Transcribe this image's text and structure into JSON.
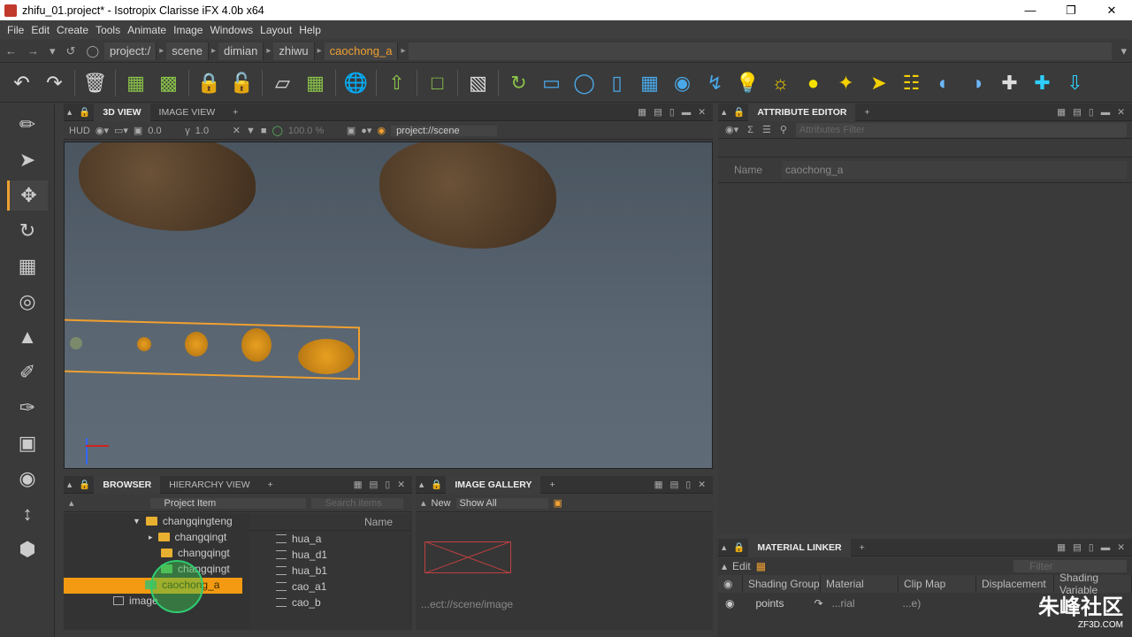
{
  "window": {
    "title": "zhifu_01.project* - Isotropix Clarisse iFX 4.0b x64"
  },
  "menu": [
    "File",
    "Edit",
    "Create",
    "Tools",
    "Animate",
    "Image",
    "Windows",
    "Layout",
    "Help"
  ],
  "path": {
    "items": [
      "project:/",
      "scene",
      "dimian",
      "zhiwu",
      "caochong_a"
    ]
  },
  "toolbar_icons": [
    "undo-icon",
    "redo-icon",
    "delete-icon",
    "group-icon",
    "ungroup-icon",
    "lock-icon",
    "unlock-icon",
    "box-icon",
    "layout-icon",
    "globe-icon",
    "import-icon",
    "chat-icon",
    "combine-icon",
    "cycle-icon",
    "cube-icon",
    "circle-icon",
    "cylinder-icon",
    "grid-icon",
    "sphere-icon",
    "curve-icon",
    "light-icon",
    "sun-icon",
    "yellow-sphere-icon",
    "flashlight-icon",
    "spotlight-icon",
    "bracket-icon",
    "ocean-icon",
    "globe2-icon",
    "cross-icon",
    "add-icon",
    "arrow-down-icon"
  ],
  "viewport": {
    "tabs": [
      "3D VIEW",
      "IMAGE VIEW"
    ],
    "hud": "HUD",
    "exposure": "0.0",
    "gamma": "1.0",
    "zoom": "100.0 %",
    "context": "project://scene"
  },
  "attribute_editor": {
    "tab": "ATTRIBUTE EDITOR",
    "filter_placeholder": "Attributes Filter",
    "name_label": "Name",
    "name_value": "caochong_a"
  },
  "browser": {
    "tabs": [
      "BROWSER",
      "HIERARCHY VIEW"
    ],
    "type_select": "Project Item",
    "search_placeholder": "Search items",
    "tree": [
      {
        "label": "changqingteng",
        "indent": 1,
        "folder": "yellow"
      },
      {
        "label": "changqingt",
        "indent": 2,
        "folder": "yellow"
      },
      {
        "label": "changqingt",
        "indent": 2,
        "folder": "yellow"
      },
      {
        "label": "changqingt",
        "indent": 2,
        "folder": "green"
      },
      {
        "label": "caochong_a",
        "indent": 1,
        "folder": "green"
      },
      {
        "label": "image",
        "indent": 0,
        "folder": "image"
      }
    ],
    "list_header": "Name",
    "list": [
      "hua_a",
      "hua_d1",
      "hua_b1",
      "cao_a1",
      "cao_b"
    ]
  },
  "image_gallery": {
    "tab": "IMAGE GALLERY",
    "new_label": "New",
    "show_select": "Show All",
    "thumb_label": "...ect://scene/image"
  },
  "material_linker": {
    "tab": "MATERIAL LINKER",
    "edit_label": "Edit",
    "filter_placeholder": "Filter",
    "columns": [
      "Shading Group",
      "Material",
      "Clip Map",
      "Displacement",
      "Shading Variable"
    ],
    "row": {
      "group": "points",
      "material": "...rial",
      "clip": "...e)"
    }
  },
  "watermark": {
    "title": "朱峰社区",
    "sub": "ZF3D.COM"
  },
  "colors": {
    "accent": "#f39a12"
  }
}
